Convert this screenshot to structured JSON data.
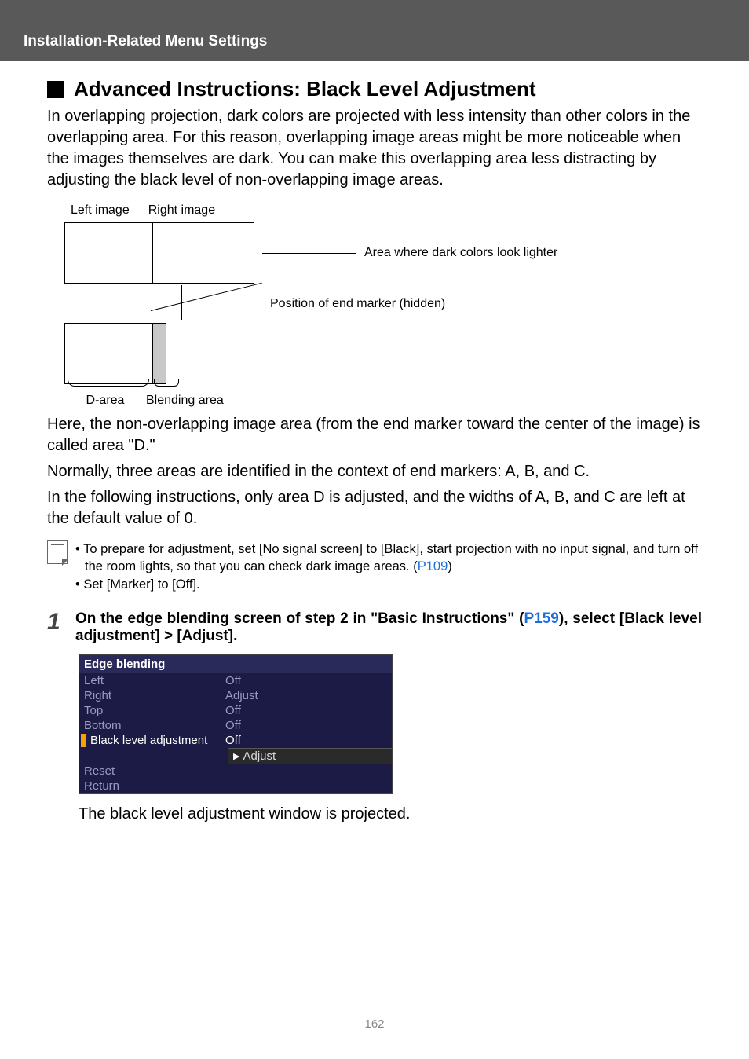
{
  "header": {
    "title": "Installation-Related Menu Settings"
  },
  "section": {
    "heading": "Advanced Instructions: Black Level Adjustment",
    "intro": "In overlapping projection, dark colors are projected with less intensity than other colors in the overlapping area. For this reason, overlapping image areas might be more noticeable when the images themselves are dark. You can make this overlapping area less distracting by adjusting the black level of non-overlapping image areas."
  },
  "diagram": {
    "left_image": "Left image",
    "right_image": "Right image",
    "area_label": "Area where dark colors look lighter",
    "position_label": "Position of end marker (hidden)",
    "d_area": "D-area",
    "blending_area": "Blending area"
  },
  "para2_a": "Here, the non-overlapping image area (from the end marker toward the center of the image) is called area \"D.\"",
  "para2_b": "Normally, three areas are identified in the context of end markers: A, B, and C.",
  "para2_c": "In the following instructions, only area D is adjusted, and the widths of A, B, and C are left at the default value of 0.",
  "notes": {
    "item1_a": "To prepare for adjustment, set [No signal screen] to [Black], start projection with no input signal, and turn off the room lights, so that you can check dark image areas. (",
    "item1_link": "P109",
    "item1_b": ")",
    "item2": "Set [Marker] to [Off]."
  },
  "step1": {
    "num": "1",
    "text_a": "On the edge blending screen of step 2 in \"Basic Instructions\" (",
    "text_link": "P159",
    "text_b": "), select [Black level adjustment] > [Adjust]."
  },
  "menu": {
    "title": "Edge blending",
    "rows": [
      {
        "k": "Left",
        "v": "Off"
      },
      {
        "k": "Right",
        "v": "Adjust"
      },
      {
        "k": "Top",
        "v": "Off"
      },
      {
        "k": "Bottom",
        "v": "Off"
      }
    ],
    "highlight": {
      "k": "Black level adjustment",
      "v": "Off"
    },
    "submenu": "Adjust",
    "rows_after": [
      {
        "k": "Reset",
        "v": ""
      },
      {
        "k": "Return",
        "v": ""
      }
    ]
  },
  "after_menu": "The black level adjustment window is projected.",
  "page_number": "162"
}
